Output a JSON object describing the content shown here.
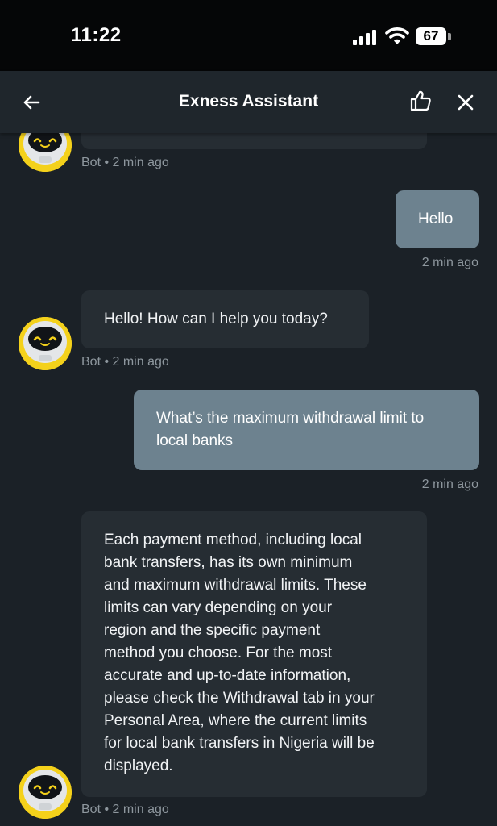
{
  "status_bar": {
    "time": "11:22",
    "battery": "67"
  },
  "header": {
    "title": "Exness Assistant"
  },
  "messages": {
    "m0": {
      "meta": "Bot • 2 min ago"
    },
    "m1": {
      "text": "Hello",
      "meta": "2 min ago"
    },
    "m2": {
      "text": "Hello! How can I help you today?",
      "meta": "Bot • 2 min ago"
    },
    "m3": {
      "line1": "What’s the maximum withdrawal limit to",
      "line2": "local banks",
      "meta": "2 min ago"
    },
    "m4": {
      "lines": [
        "Each payment method, including local",
        "bank transfers, has its own minimum",
        "and maximum withdrawal limits. These",
        "limits can vary depending on your",
        "region and the specific payment",
        "method you choose. For the most",
        "accurate and up-to-date information,",
        "please check the Withdrawal tab in your",
        "Personal Area, where the current limits",
        "for local bank transfers in Nigeria will be",
        "displayed."
      ],
      "meta": "Bot • 2 min ago"
    }
  },
  "colors": {
    "background": "#1b2127",
    "header": "#1f262c",
    "bot_bubble": "#262d33",
    "user_bubble": "#6d828f",
    "avatar_yellow": "#f4d11b"
  }
}
